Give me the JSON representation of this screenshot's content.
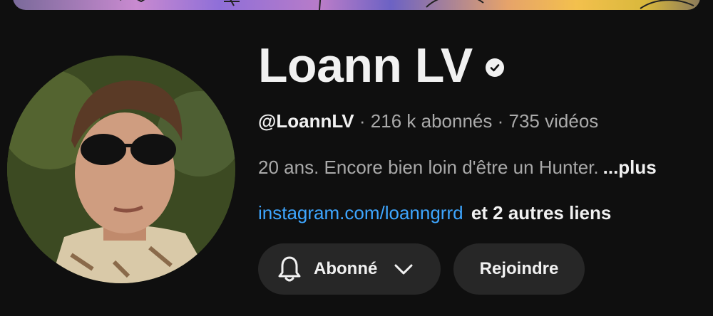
{
  "channel": {
    "name": "Loann LV",
    "handle": "@LoannLV",
    "subscribers": "216 k abonnés",
    "videos": "735 vidéos",
    "separator": "·",
    "description": "20 ans. Encore bien loin d'être un Hunter.",
    "more_label": "...plus",
    "link_text": "instagram.com/loanngrrd",
    "other_links": "et 2 autres liens"
  },
  "actions": {
    "subscribed_label": "Abonné",
    "join_label": "Rejoindre"
  },
  "icons": {
    "verified": "verified-check-icon",
    "bell": "bell-icon",
    "chevron": "chevron-down-icon"
  },
  "colors": {
    "background": "#0f0f0f",
    "button_bg": "#272727",
    "link": "#3ea6ff",
    "secondary_text": "#aaaaaa",
    "primary_text": "#f1f1f1"
  }
}
